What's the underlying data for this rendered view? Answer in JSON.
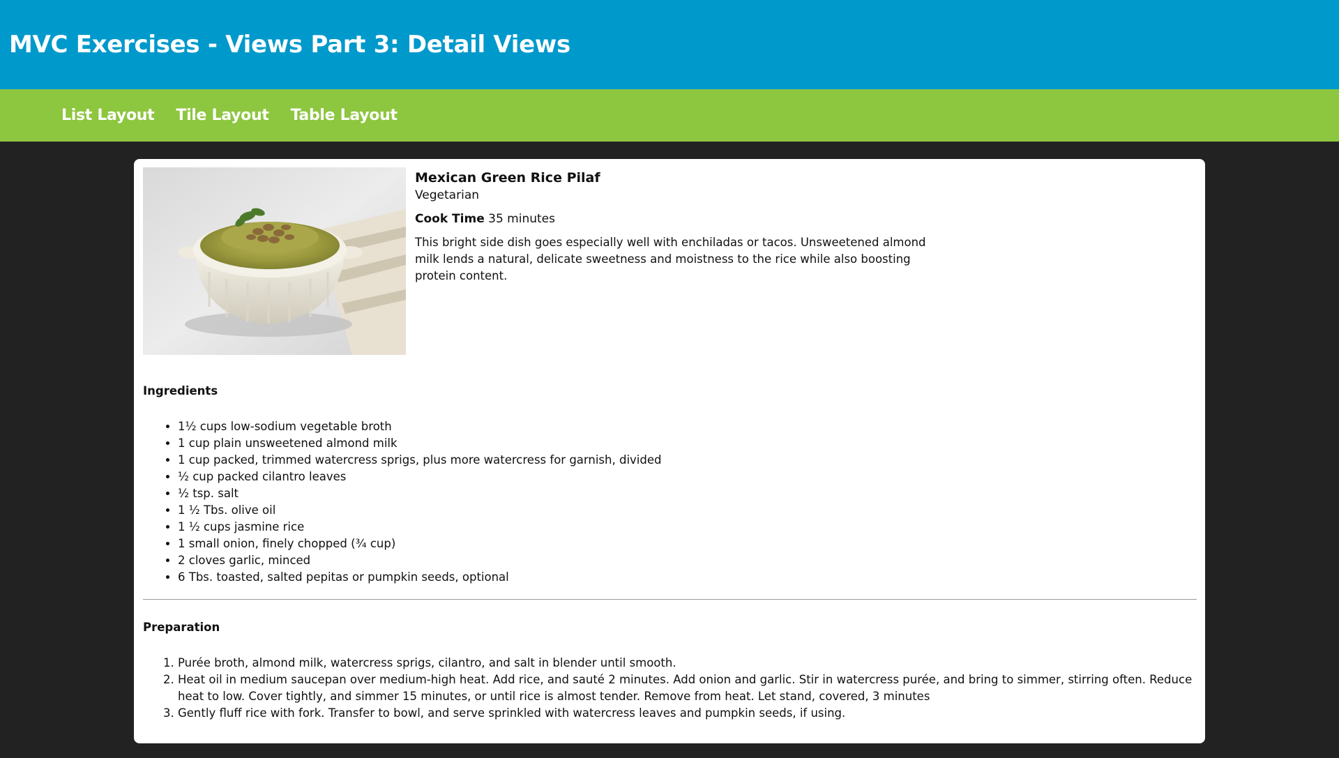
{
  "header": {
    "title": "MVC Exercises - Views Part 3: Detail Views",
    "background_color": "#0099cc"
  },
  "nav": {
    "background_color": "#8dc63f",
    "items": [
      {
        "label": "List Layout"
      },
      {
        "label": "Tile Layout"
      },
      {
        "label": "Table Layout"
      }
    ]
  },
  "recipe": {
    "image_subject": "bowl-of-green-rice-pilaf-photo",
    "name": "Mexican Green Rice Pilaf",
    "category": "Vegetarian",
    "cook_time_label": "Cook Time",
    "cook_time_value": "35 minutes",
    "description": "This bright side dish goes especially well with enchiladas or tacos. Unsweetened almond milk lends a natural, delicate sweetness and moistness to the rice while also boosting protein content.",
    "ingredients_title": "Ingredients",
    "ingredients": [
      "1½ cups low-sodium vegetable broth",
      "1 cup plain unsweetened almond milk",
      "1 cup packed, trimmed watercress sprigs, plus more watercress for garnish, divided",
      "½ cup packed cilantro leaves",
      "½ tsp. salt",
      "1 ½ Tbs. olive oil",
      "1 ½ cups jasmine rice",
      "1 small onion, finely chopped (¾ cup)",
      "2 cloves garlic, minced",
      "6 Tbs. toasted, salted pepitas or pumpkin seeds, optional"
    ],
    "preparation_title": "Preparation",
    "steps": [
      "Purée broth, almond milk, watercress sprigs, cilantro, and salt in blender until smooth.",
      "Heat oil in medium saucepan over medium-high heat. Add rice, and sauté 2 minutes. Add onion and garlic. Stir in watercress purée, and bring to simmer, stirring often. Reduce heat to low. Cover tightly, and simmer 15 minutes, or until rice is almost tender. Remove from heat. Let stand, covered, 3 minutes",
      "Gently fluff rice with fork. Transfer to bowl, and serve sprinkled with watercress leaves and pumpkin seeds, if using."
    ]
  }
}
